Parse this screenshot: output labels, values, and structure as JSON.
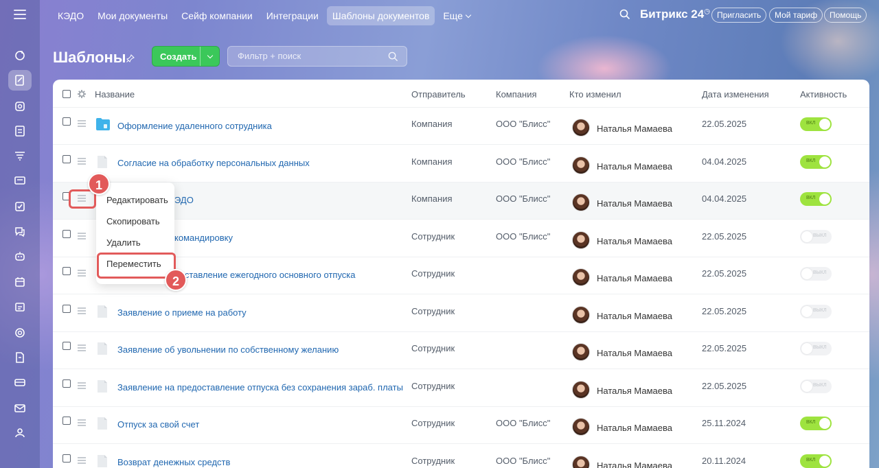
{
  "topnav": {
    "items": [
      "КЭДО",
      "Мои документы",
      "Сейф компании",
      "Интеграции",
      "Шаблоны документов",
      "Еще"
    ],
    "active_index": 4,
    "brand": "Битрикс 24",
    "invite": "Пригласить",
    "tariff": "Мой тариф",
    "help": "Помощь"
  },
  "page": {
    "title": "Шаблоны",
    "create_label": "Создать",
    "filter_placeholder": "Фильтр + поиск"
  },
  "table": {
    "headers": [
      "Название",
      "Отправитель",
      "Компания",
      "Кто изменил",
      "Дата изменения",
      "Активность"
    ],
    "rows": [
      {
        "name": "Оформление удаленного сотрудника",
        "sender": "Компания",
        "company": "ООО \"Блисс\"",
        "user": "Наталья Мамаева",
        "date": "22.05.2025",
        "active": true,
        "folder": true
      },
      {
        "name": "Согласие на обработку персональных данных",
        "sender": "Компания",
        "company": "ООО \"Блисс\"",
        "user": "Наталья Мамаева",
        "date": "04.04.2025",
        "active": true
      },
      {
        "name": "ЭДО",
        "sender": "Компания",
        "company": "ООО \"Блисс\"",
        "user": "Наталья Мамаева",
        "date": "04.04.2025",
        "active": true
      },
      {
        "name": "командировку",
        "sender": "Сотрудник",
        "company": "ООО \"Блисс\"",
        "user": "Наталья Мамаева",
        "date": "22.05.2025",
        "active": false
      },
      {
        "name": "доставление ежегодного основного отпуска",
        "sender": "Сотрудник",
        "company": "",
        "user": "Наталья Мамаева",
        "date": "22.05.2025",
        "active": false
      },
      {
        "name": "Заявление о приеме на работу",
        "sender": "Сотрудник",
        "company": "",
        "user": "Наталья Мамаева",
        "date": "22.05.2025",
        "active": false
      },
      {
        "name": "Заявление об увольнении по собственному желанию",
        "sender": "Сотрудник",
        "company": "",
        "user": "Наталья Мамаева",
        "date": "22.05.2025",
        "active": false
      },
      {
        "name": "Заявление на предоставление отпуска без сохранения зараб. платы",
        "sender": "Сотрудник",
        "company": "",
        "user": "Наталья Мамаева",
        "date": "22.05.2025",
        "active": false
      },
      {
        "name": "Отпуск за свой счет",
        "sender": "Сотрудник",
        "company": "ООО \"Блисс\"",
        "user": "Наталья Мамаева",
        "date": "25.11.2024",
        "active": true
      },
      {
        "name": "Возврат денежных средств",
        "sender": "Сотрудник",
        "company": "ООО \"Блисс\"",
        "user": "Наталья Мамаева",
        "date": "20.11.2024",
        "active": true
      }
    ],
    "toggle_on": "ВКЛ",
    "toggle_off": "ВЫКЛ"
  },
  "context_menu": {
    "items": [
      "Редактировать",
      "Скопировать",
      "Удалить",
      "Переместить"
    ]
  },
  "badges": [
    "1",
    "2"
  ],
  "colors": {
    "accent_green": "#3bc85a",
    "toggle_on": "#9ee33f",
    "link": "#2067b0",
    "highlight": "#e25a5a"
  },
  "icons": {
    "rail": [
      "refresh-icon",
      "document-sign-icon",
      "safe-icon",
      "notes-icon",
      "filter-icon",
      "contacts-card-icon",
      "tasks-check-icon",
      "chat-icon",
      "robot-icon",
      "calendar-icon",
      "calendar-list-icon",
      "target-icon",
      "document-icon",
      "card-icon",
      "mail-icon",
      "team-icon"
    ]
  }
}
